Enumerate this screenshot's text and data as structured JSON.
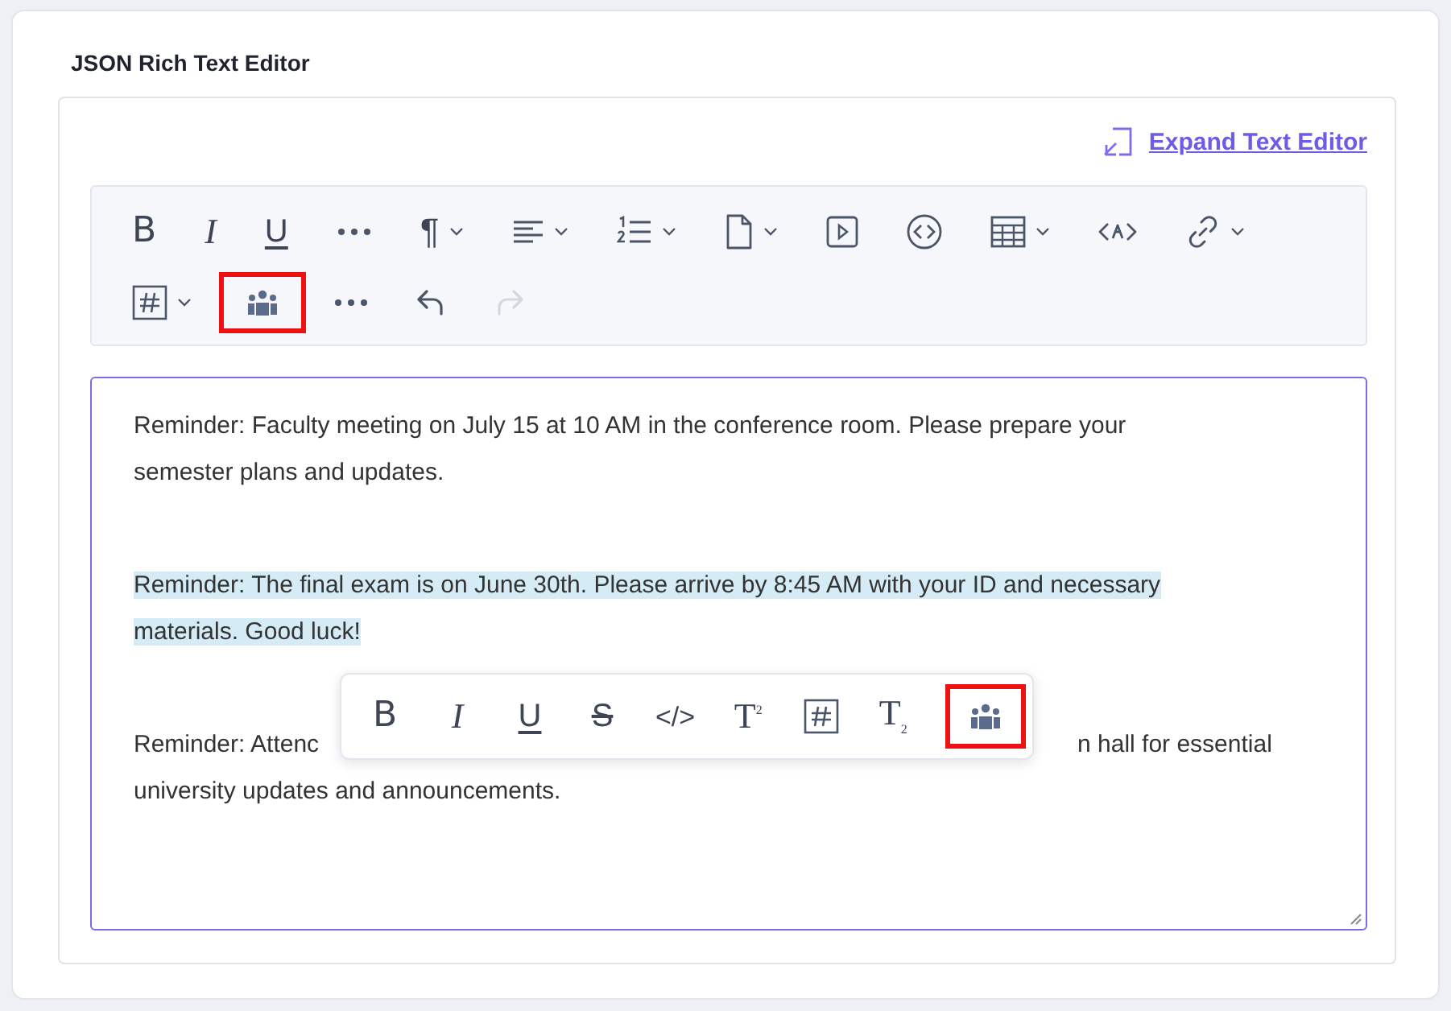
{
  "title": "JSON Rich Text Editor",
  "expand_link": {
    "label": "Expand Text Editor"
  },
  "toolbar": {
    "rows": [
      [
        {
          "kind": "bold",
          "label": "B",
          "dropdown": false,
          "highlighted": false,
          "disabled": false
        },
        {
          "kind": "italic",
          "label": "I",
          "dropdown": false,
          "highlighted": false,
          "disabled": false
        },
        {
          "kind": "underline",
          "label": "U",
          "dropdown": false,
          "highlighted": false,
          "disabled": false
        },
        {
          "kind": "more",
          "dropdown": false,
          "highlighted": false,
          "disabled": false
        },
        {
          "kind": "paragraph",
          "label": "¶",
          "dropdown": true,
          "highlighted": false,
          "disabled": false
        },
        {
          "kind": "align",
          "dropdown": true,
          "highlighted": false,
          "disabled": false
        },
        {
          "kind": "ordered-list",
          "dropdown": true,
          "highlighted": false,
          "disabled": false
        },
        {
          "kind": "document",
          "dropdown": true,
          "highlighted": false,
          "disabled": false
        },
        {
          "kind": "video",
          "dropdown": false,
          "highlighted": false,
          "disabled": false
        },
        {
          "kind": "embed",
          "dropdown": false,
          "highlighted": false,
          "disabled": false
        },
        {
          "kind": "table",
          "dropdown": true,
          "highlighted": false,
          "disabled": false
        },
        {
          "kind": "source",
          "dropdown": false,
          "highlighted": false,
          "disabled": false
        },
        {
          "kind": "link",
          "dropdown": true,
          "highlighted": false,
          "disabled": false
        }
      ],
      [
        {
          "kind": "hashtag",
          "dropdown": true,
          "highlighted": false,
          "disabled": false
        },
        {
          "kind": "people",
          "dropdown": false,
          "highlighted": true,
          "disabled": false
        },
        {
          "kind": "more",
          "dropdown": false,
          "highlighted": false,
          "disabled": false
        },
        {
          "kind": "undo",
          "dropdown": false,
          "highlighted": false,
          "disabled": false
        },
        {
          "kind": "redo",
          "dropdown": false,
          "highlighted": false,
          "disabled": true
        }
      ]
    ]
  },
  "paragraphs": [
    {
      "lines": [
        [
          "Reminder: Faculty meeting on July 15 at 10 AM in the conference room. Please prepare your"
        ],
        [
          "semester plans and updates."
        ]
      ],
      "selected": false
    },
    {
      "lines": [
        [
          "Reminder: The final exam is on June 30th. Please arrive by 8:45 AM with your ID and necessary"
        ],
        [
          "materials. Good luck!"
        ]
      ],
      "selected": true
    },
    {
      "lines": [
        [
          "Reminder: Attenc",
          "n hall for essential"
        ],
        [
          "university updates and announcements."
        ]
      ],
      "selected": false
    }
  ],
  "inline_toolbar": [
    {
      "kind": "bold",
      "label": "B",
      "highlighted": false
    },
    {
      "kind": "italic",
      "label": "I",
      "highlighted": false
    },
    {
      "kind": "underline",
      "label": "U",
      "highlighted": false
    },
    {
      "kind": "strikethrough",
      "label": "S",
      "highlighted": false
    },
    {
      "kind": "code",
      "label": "</>",
      "highlighted": false
    },
    {
      "kind": "superscript",
      "label": "T",
      "mark": "2",
      "highlighted": false
    },
    {
      "kind": "hashtag",
      "highlighted": false
    },
    {
      "kind": "subscript",
      "label": "T",
      "mark": "2",
      "highlighted": false
    },
    {
      "kind": "people",
      "highlighted": true
    }
  ]
}
